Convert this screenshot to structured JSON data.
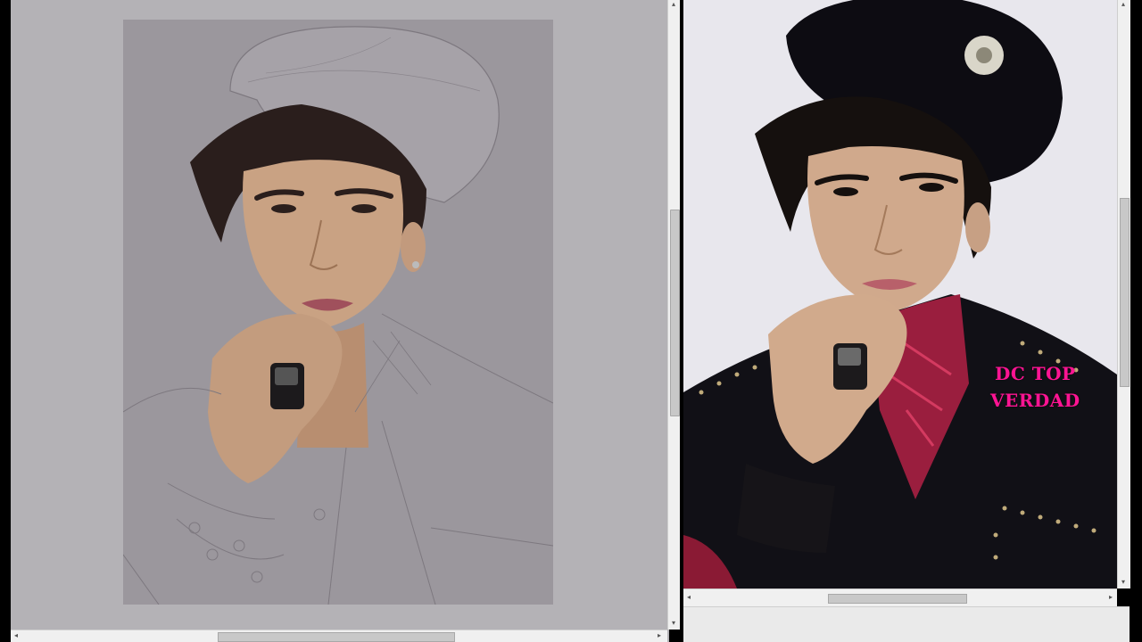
{
  "panes": {
    "left": {
      "name": "painting-canvas"
    },
    "right": {
      "name": "reference-photo"
    }
  },
  "watermark": {
    "line1": "DC TOP",
    "line2": "VERDAD",
    "color": "#ff1493"
  },
  "colors": {
    "canvas_bg": "#9b979d",
    "workspace_bg": "#b4b2b6",
    "scrollbar_bg": "#f0f0f0",
    "scrollbar_thumb": "#c8c8c8"
  },
  "icons": {
    "arrow_left": "◂",
    "arrow_right": "▸",
    "arrow_up": "▴",
    "arrow_down": "▾"
  }
}
